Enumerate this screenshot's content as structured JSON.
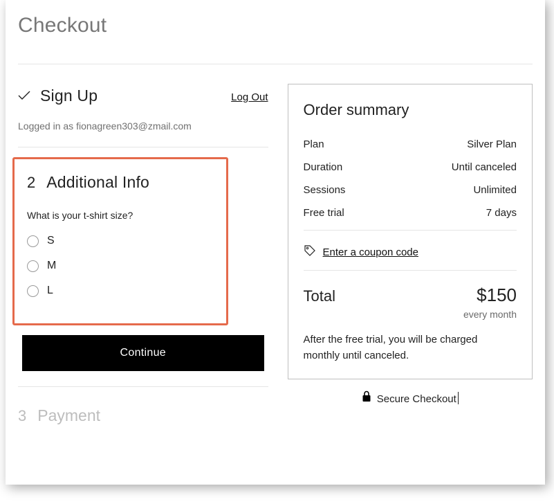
{
  "page": {
    "title": "Checkout"
  },
  "step1": {
    "title": "Sign Up",
    "logout": "Log Out",
    "logged_in_prefix": "Logged in as ",
    "email": "fionagreen303@zmail.com"
  },
  "step2": {
    "number": "2",
    "title": "Additional Info",
    "question": "What is your t-shirt size?",
    "options": [
      "S",
      "M",
      "L"
    ],
    "continue": "Continue"
  },
  "step3": {
    "number": "3",
    "title": "Payment"
  },
  "summary": {
    "title": "Order summary",
    "rows": [
      {
        "label": "Plan",
        "value": "Silver Plan"
      },
      {
        "label": "Duration",
        "value": "Until canceled"
      },
      {
        "label": "Sessions",
        "value": "Unlimited"
      },
      {
        "label": "Free trial",
        "value": "7 days"
      }
    ],
    "coupon": "Enter a coupon code",
    "total_label": "Total",
    "total_amount": "$150",
    "total_period": "every month",
    "trial_note": "After the free trial, you will be charged monthly until canceled.",
    "secure": "Secure Checkout"
  }
}
